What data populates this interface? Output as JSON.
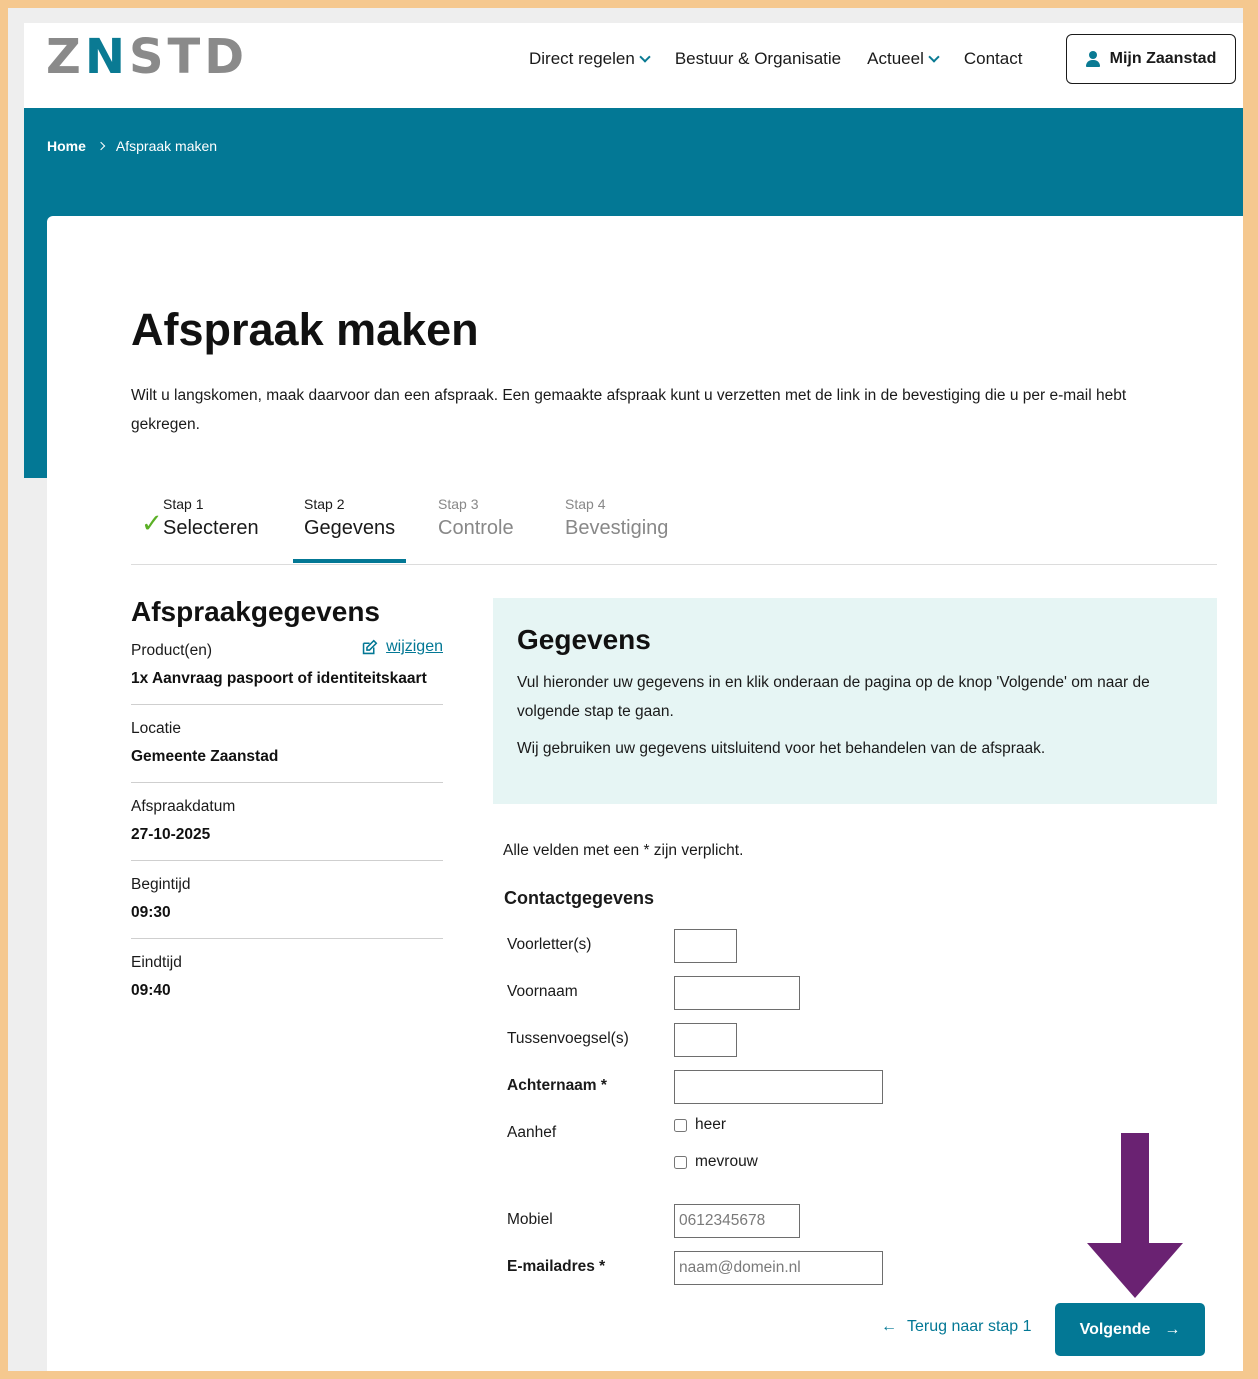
{
  "header": {
    "logo_text_left": "Z",
    "logo_text_n": "N",
    "logo_text_right": "STD",
    "nav": [
      {
        "label": "Direct regelen",
        "dropdown": true
      },
      {
        "label": "Bestuur & Organisatie",
        "dropdown": false
      },
      {
        "label": "Actueel",
        "dropdown": true
      },
      {
        "label": "Contact",
        "dropdown": false
      }
    ],
    "account_button": "Mijn Zaanstad"
  },
  "breadcrumb": {
    "home": "Home",
    "current": "Afspraak maken"
  },
  "page": {
    "title": "Afspraak maken",
    "intro": "Wilt u langskomen, maak daarvoor dan een afspraak. Een gemaakte afspraak kunt u verzetten met de link in de bevestiging die u per e-mail hebt gekregen."
  },
  "steps": [
    {
      "num": "Stap 1",
      "label": "Selecteren",
      "state": "done"
    },
    {
      "num": "Stap 2",
      "label": "Gegevens",
      "state": "active"
    },
    {
      "num": "Stap 3",
      "label": "Controle",
      "state": "pending"
    },
    {
      "num": "Stap 4",
      "label": "Bevestiging",
      "state": "pending"
    }
  ],
  "summary": {
    "title": "Afspraakgegevens",
    "edit_label": "wijzigen",
    "items": [
      {
        "label": "Product(en)",
        "value": "1x Aanvraag paspoort of identiteitskaart"
      },
      {
        "label": "Locatie",
        "value": "Gemeente Zaanstad"
      },
      {
        "label": "Afspraakdatum",
        "value": "27-10-2025"
      },
      {
        "label": "Begintijd",
        "value": "09:30"
      },
      {
        "label": "Eindtijd",
        "value": "09:40"
      }
    ]
  },
  "info": {
    "title": "Gegevens",
    "text1": "Vul hieronder uw gegevens in en klik onderaan de pagina op de knop 'Volgende' om naar de volgende stap te gaan.",
    "text2": "Wij gebruiken uw gegevens uitsluitend voor het behandelen van de afspraak."
  },
  "form": {
    "required_note": "Alle velden met een * zijn verplicht.",
    "section_title": "Contactgegevens",
    "fields": {
      "initials": {
        "label": "Voorletter(s)",
        "value": ""
      },
      "firstname": {
        "label": "Voornaam",
        "value": ""
      },
      "infix": {
        "label": "Tussenvoegsel(s)",
        "value": ""
      },
      "lastname": {
        "label": "Achternaam *",
        "value": ""
      },
      "salutation": {
        "label": "Aanhef",
        "options": [
          "heer",
          "mevrouw"
        ]
      },
      "mobile": {
        "label": "Mobiel",
        "placeholder": "0612345678"
      },
      "email": {
        "label": "E-mailadres *",
        "placeholder": "naam@domein.nl"
      }
    },
    "back_label": "Terug naar stap 1",
    "next_label": "Volgende"
  },
  "colors": {
    "brand_teal": "#037895",
    "check_green": "#5bb026",
    "annotation_arrow": "#6a2272",
    "frame": "#f5c88f"
  }
}
